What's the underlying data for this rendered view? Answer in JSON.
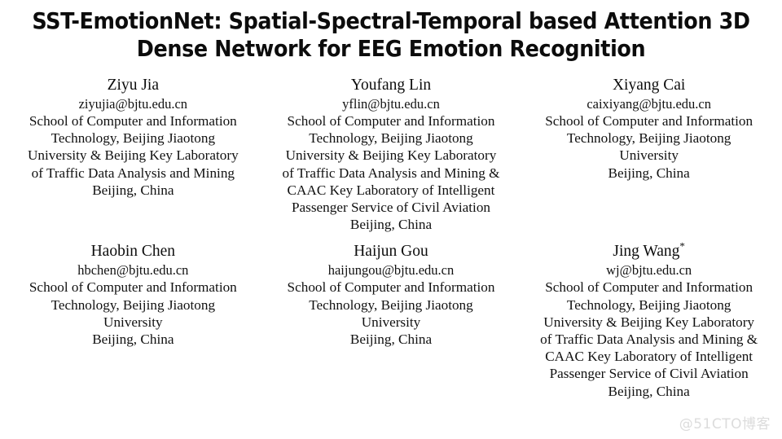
{
  "document": {
    "type": "paper-header",
    "background_color": "#ffffff",
    "text_color": "#111111"
  },
  "title": {
    "line1": "SST-EmotionNet: Spatial-Spectral-Temporal based Attention 3D",
    "line2": "Dense Network for EEG Emotion Recognition"
  },
  "authors": [
    {
      "name": "Ziyu Jia",
      "corresponding_mark": "",
      "email": "ziyujia@bjtu.edu.cn",
      "affiliation_lines": [
        "School of Computer and Information",
        "Technology, Beijing Jiaotong",
        "University & Beijing Key Laboratory",
        "of Traffic Data Analysis and Mining",
        "Beijing, China"
      ]
    },
    {
      "name": "Youfang Lin",
      "corresponding_mark": "",
      "email": "yflin@bjtu.edu.cn",
      "affiliation_lines": [
        "School of Computer and Information",
        "Technology, Beijing Jiaotong",
        "University & Beijing Key Laboratory",
        "of Traffic Data Analysis and Mining &",
        "CAAC Key Laboratory of Intelligent",
        "Passenger Service of Civil Aviation",
        "Beijing, China"
      ]
    },
    {
      "name": "Xiyang Cai",
      "corresponding_mark": "",
      "email": "caixiyang@bjtu.edu.cn",
      "affiliation_lines": [
        "School of Computer and Information",
        "Technology, Beijing Jiaotong",
        "University",
        "Beijing, China"
      ]
    },
    {
      "name": "Haobin Chen",
      "corresponding_mark": "",
      "email": "hbchen@bjtu.edu.cn",
      "affiliation_lines": [
        "School of Computer and Information",
        "Technology, Beijing Jiaotong",
        "University",
        "Beijing, China"
      ]
    },
    {
      "name": "Haijun Gou",
      "corresponding_mark": "",
      "email": "haijungou@bjtu.edu.cn",
      "affiliation_lines": [
        "School of Computer and Information",
        "Technology, Beijing Jiaotong",
        "University",
        "Beijing, China"
      ]
    },
    {
      "name": "Jing Wang",
      "corresponding_mark": "*",
      "email": "wj@bjtu.edu.cn",
      "affiliation_lines": [
        "School of Computer and Information",
        "Technology, Beijing Jiaotong",
        "University & Beijing Key Laboratory",
        "of Traffic Data Analysis and Mining &",
        "CAAC Key Laboratory of Intelligent",
        "Passenger Service of Civil Aviation",
        "Beijing, China"
      ]
    }
  ],
  "watermark": {
    "text": "@51CTO博客",
    "color": "#dcdcdc"
  }
}
